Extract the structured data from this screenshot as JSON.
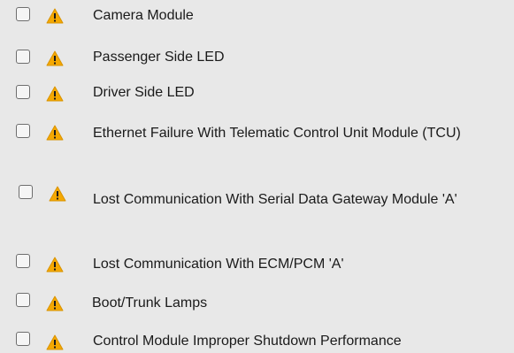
{
  "items": [
    {
      "label": "Camera Module"
    },
    {
      "label": "Passenger Side LED"
    },
    {
      "label": "Driver Side LED"
    },
    {
      "label": "Ethernet Failure With Telematic Control Unit Module (TCU)"
    },
    {
      "label": "Lost Communication With Serial Data Gateway Module 'A'"
    },
    {
      "label": "Lost Communication With ECM/PCM 'A'"
    },
    {
      "label": "Boot/Trunk Lamps"
    },
    {
      "label": "Control Module Improper Shutdown Performance"
    }
  ],
  "icons": {
    "warning": "warning-icon",
    "warning_fill": "#f5a800",
    "warning_mark": "#1a1a1a"
  }
}
